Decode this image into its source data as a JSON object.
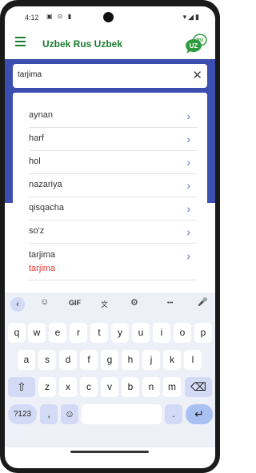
{
  "status": {
    "time": "4:12",
    "left_icons": "▣ ⊙ ▮",
    "right_icons": "▾◢▮"
  },
  "app": {
    "title": "Uzbek Rus Uzbek",
    "logo_icon": "speech-bubbles-logo-icon",
    "logo_text": "UZ",
    "logo_badge": "RU",
    "accent": "#1b7a2d",
    "band_color": "#3c4fb0"
  },
  "search": {
    "value": "tarjima",
    "clear_icon": "✕"
  },
  "list": {
    "items": [
      {
        "label": "aynan"
      },
      {
        "label": "harf"
      },
      {
        "label": "hol"
      },
      {
        "label": "nazariya"
      },
      {
        "label": "qisqacha"
      },
      {
        "label": "so'z"
      },
      {
        "label": "tarjima",
        "sub": "tarjima"
      }
    ],
    "chevron": "›"
  },
  "keyboard": {
    "toolbar": {
      "back": "‹",
      "sticker": "☺",
      "gif": "GIF",
      "translate": "文",
      "settings": "⚙",
      "more": "•••",
      "mic": "🎤"
    },
    "row1": [
      "q",
      "w",
      "e",
      "r",
      "t",
      "y",
      "u",
      "i",
      "o",
      "p"
    ],
    "row2": [
      "a",
      "s",
      "d",
      "f",
      "g",
      "h",
      "j",
      "k",
      "l"
    ],
    "row3": [
      "z",
      "x",
      "c",
      "v",
      "b",
      "n",
      "m"
    ],
    "shift": "⇧",
    "backspace": "⌫",
    "symbols": "?123",
    "comma": ",",
    "emoji": "☺",
    "period": ".",
    "enter": "↵"
  }
}
